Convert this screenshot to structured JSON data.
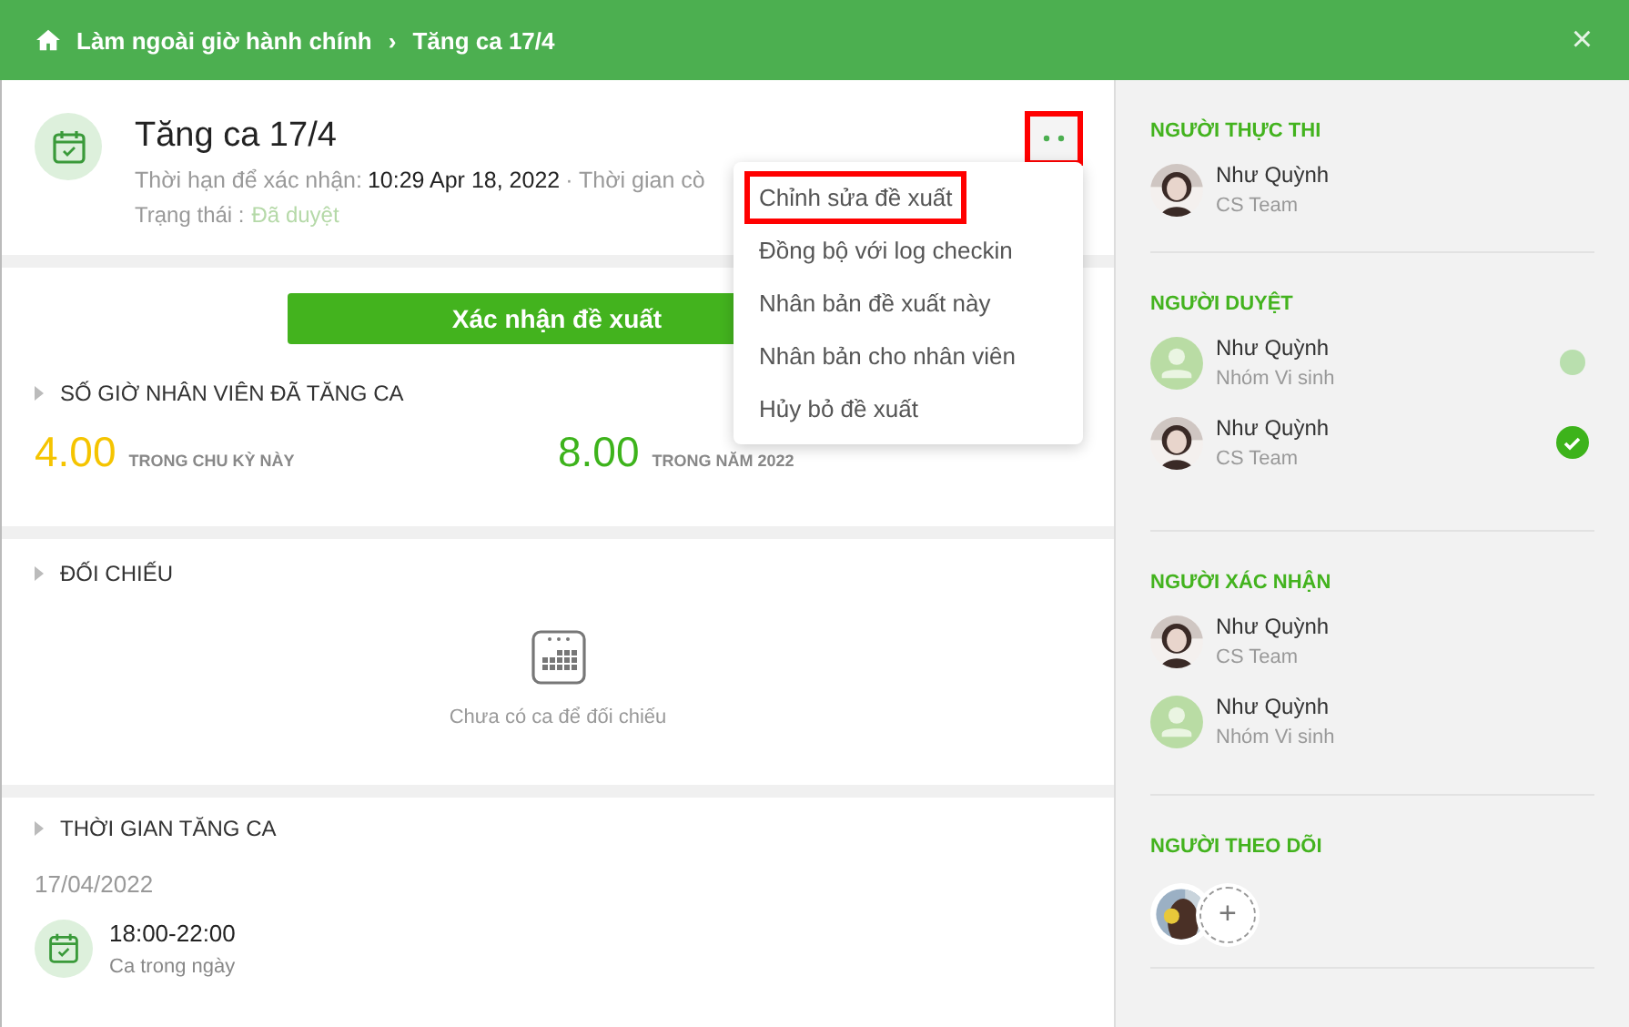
{
  "header": {
    "breadcrumb": [
      {
        "label": "Làm ngoài giờ hành chính"
      },
      {
        "label": "Tăng ca 17/4"
      }
    ],
    "separator": "›",
    "close": "×"
  },
  "request": {
    "title": "Tăng ca 17/4",
    "deadline_label": "Thời hạn để xác nhận:",
    "deadline": "10:29 Apr 18, 2022",
    "remaining_label": "· Thời gian cò",
    "status_label": "Trạng thái :",
    "status": "Đã duyệt",
    "more_highlighted": true
  },
  "menu": [
    {
      "label": "Chỉnh sửa đề xuất",
      "highlighted": true
    },
    {
      "label": "Đồng bộ với log checkin",
      "highlighted": false
    },
    {
      "label": "Nhân bản đề xuất này",
      "highlighted": false
    },
    {
      "label": "Nhân bản cho nhân viên",
      "highlighted": false
    },
    {
      "label": "Hủy bỏ đề xuất",
      "highlighted": false
    }
  ],
  "confirm_button": "Xác nhận đề xuất",
  "hours": {
    "title": "SỐ GIỜ NHÂN VIÊN ĐÃ TĂNG CA",
    "stats": [
      {
        "value": "4.00",
        "label": "TRONG CHU KỲ NÀY",
        "color": "#f5c400"
      },
      {
        "value": "8.00",
        "label": "TRONG NĂM 2022",
        "color": "#3db31b"
      }
    ]
  },
  "compare": {
    "title": "ĐỐI CHIẾU",
    "empty": "Chưa có ca để đối chiếu"
  },
  "overtime": {
    "title": "THỜI GIAN TĂNG CA",
    "date": "17/04/2022",
    "shift": {
      "time": "18:00-22:00",
      "label": "Ca trong ngày"
    }
  },
  "sidebar": [
    {
      "title": "NGƯỜI THỰC THI",
      "people": [
        {
          "name": "Như Quỳnh",
          "team": "CS Team"
        }
      ]
    },
    {
      "title": "NGƯỜI DUYỆT",
      "people": [
        {
          "name": "Như Quỳnh",
          "team": "Nhóm Vi sinh",
          "kind": "placeholder",
          "approved": false
        },
        {
          "name": "Như Quỳnh",
          "team": "CS Team",
          "approved": true
        }
      ]
    },
    {
      "title": "NGƯỜI XÁC NHẬN",
      "people": [
        {
          "name": "Như Quỳnh",
          "team": "CS Team"
        },
        {
          "name": "Như Quỳnh",
          "team": "Nhóm Vi sinh",
          "kind": "placeholder"
        }
      ]
    },
    {
      "title": "NGƯỜI THEO DÕI",
      "add": "+"
    }
  ]
}
